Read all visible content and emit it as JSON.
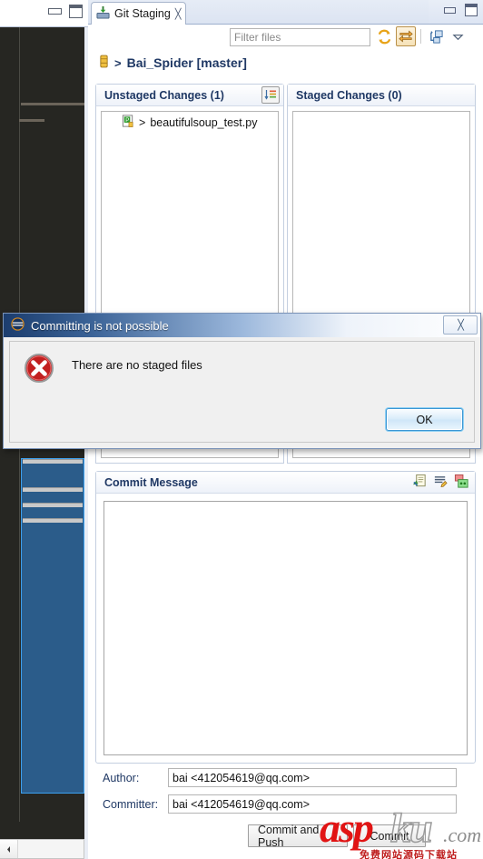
{
  "editor": {
    "window_buttons": {
      "minimize": "minimize-window",
      "maximize": "maximize-window"
    }
  },
  "view": {
    "tab": {
      "label": "Git Staging",
      "close": "╳",
      "icon": "git-staging-icon"
    },
    "window_buttons": {
      "minimize": "minimize-view",
      "maximize": "maximize-view"
    },
    "toolbar": {
      "filter": {
        "placeholder": "Filter files",
        "value": ""
      },
      "icons": [
        {
          "name": "refresh-icon",
          "label": "Refresh"
        },
        {
          "name": "link-selection-icon",
          "label": "Link with Editor and Selection",
          "pressed": true
        },
        {
          "name": "view-menu-layout-icon",
          "label": "Presentation"
        },
        {
          "name": "view-menu-chevron-icon",
          "label": "View Menu"
        }
      ]
    },
    "repository": {
      "icon": "repository-icon",
      "separator": ">",
      "name": "Bai_Spider [master]"
    },
    "unstaged": {
      "title": "Unstaged Changes (1)",
      "sort_icon": "sort-icon",
      "files": [
        {
          "icon": "python-file-icon",
          "arrow": ">",
          "name": "beautifulsoup_test.py"
        }
      ]
    },
    "staged": {
      "title": "Staged Changes (0)",
      "files": []
    },
    "commit_message": {
      "title": "Commit Message",
      "value": "",
      "icons": [
        {
          "name": "add-signed-off-icon",
          "label": "Add Signed-off-by"
        },
        {
          "name": "add-change-id-icon",
          "label": "Add Change-Id"
        },
        {
          "name": "amend-commit-icon",
          "label": "Amend Previous Commit"
        }
      ]
    },
    "fields": [
      {
        "label": "Author:",
        "value": "bai <412054619@qq.com>"
      },
      {
        "label": "Committer:",
        "value": "bai <412054619@qq.com>"
      }
    ],
    "buttons": [
      {
        "name": "commit-and-push-button",
        "label": "Commit and Push"
      },
      {
        "name": "commit-button",
        "label": "Commit"
      }
    ]
  },
  "dialog": {
    "icon": "eclipse-icon",
    "title": "Committing is not possible",
    "close_label": "╳",
    "error_icon": "error-icon",
    "message": "There are no staged files",
    "ok_label": "OK"
  },
  "watermark": {
    "part1": "asp",
    "part2": "ku",
    "part3": ".com",
    "subtitle": "免费网站源码下载站"
  },
  "colors": {
    "accent_blue": "#1f3864",
    "dialog_title_blue": "#1c3d6e",
    "error_red": "#c0392b",
    "editor_bg": "#262622",
    "selection_blue": "#2b5c8a"
  }
}
